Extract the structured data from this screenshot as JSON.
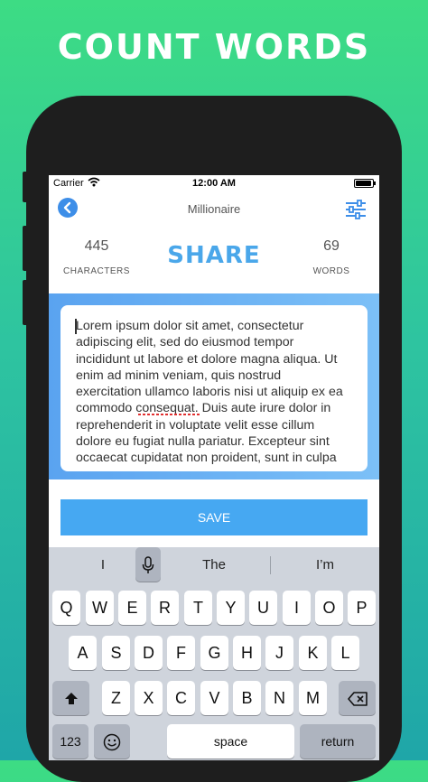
{
  "headline": "COUNT WORDS",
  "status": {
    "carrier": "Carrier",
    "time": "12:00 AM"
  },
  "nav": {
    "title": "Millionaire",
    "back_icon": "chevron-left-icon",
    "filter_icon": "sliders-icon"
  },
  "stats": {
    "characters": {
      "value": "445",
      "label": "CHARACTERS"
    },
    "words": {
      "value": "69",
      "label": "WORDS"
    }
  },
  "share_label": "SHARE",
  "text_body": "Lorem ipsum dolor sit amet, consectetur\nadipiscing elit, sed do eiusmod tempor\nincididunt ut labore et dolore magna aliqua. Ut\nenim ad minim veniam, quis nostrud\nexercitation ullamco laboris nisi ut aliquip ex ea\ncommodo consequat. Duis aute irure dolor in\nreprehenderit in voluptate velit esse cillum\ndolore eu fugiat nulla pariatur. Excepteur sint\noccaecat cupidatat non proident, sunt in culpa",
  "save_label": "SAVE",
  "keyboard": {
    "suggestions": [
      "I",
      "The",
      "I’m"
    ],
    "row1": [
      "Q",
      "W",
      "E",
      "R",
      "T",
      "Y",
      "U",
      "I",
      "O",
      "P"
    ],
    "row2": [
      "A",
      "S",
      "D",
      "F",
      "G",
      "H",
      "J",
      "K",
      "L"
    ],
    "row3": [
      "Z",
      "X",
      "C",
      "V",
      "B",
      "N",
      "M"
    ],
    "numbers_label": "123",
    "space_label": "space",
    "return_label": "return"
  },
  "colors": {
    "accent": "#46a8f2",
    "share": "#4aa7ea",
    "background_top": "#3ddc84",
    "background_bottom": "#1fa6a8"
  }
}
